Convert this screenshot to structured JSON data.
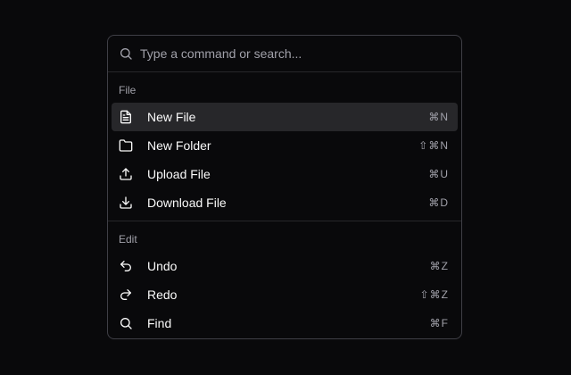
{
  "search": {
    "placeholder": "Type a command or search...",
    "icon": "search-icon"
  },
  "groups": [
    {
      "heading": "File",
      "items": [
        {
          "label": "New File",
          "shortcut": "⌘N",
          "icon": "file-text-icon",
          "selected": true
        },
        {
          "label": "New Folder",
          "shortcut": "⇧⌘N",
          "icon": "folder-icon"
        },
        {
          "label": "Upload File",
          "shortcut": "⌘U",
          "icon": "upload-icon"
        },
        {
          "label": "Download File",
          "shortcut": "⌘D",
          "icon": "download-icon"
        }
      ]
    },
    {
      "heading": "Edit",
      "items": [
        {
          "label": "Undo",
          "shortcut": "⌘Z",
          "icon": "undo-icon"
        },
        {
          "label": "Redo",
          "shortcut": "⇧⌘Z",
          "icon": "redo-icon"
        },
        {
          "label": "Find",
          "shortcut": "⌘F",
          "icon": "search-icon"
        }
      ]
    }
  ],
  "colors": {
    "background": "#09090b",
    "border": "#3f3f46",
    "selected": "#27272a",
    "muted_text": "#a1a1aa",
    "text": "#fafafa"
  }
}
